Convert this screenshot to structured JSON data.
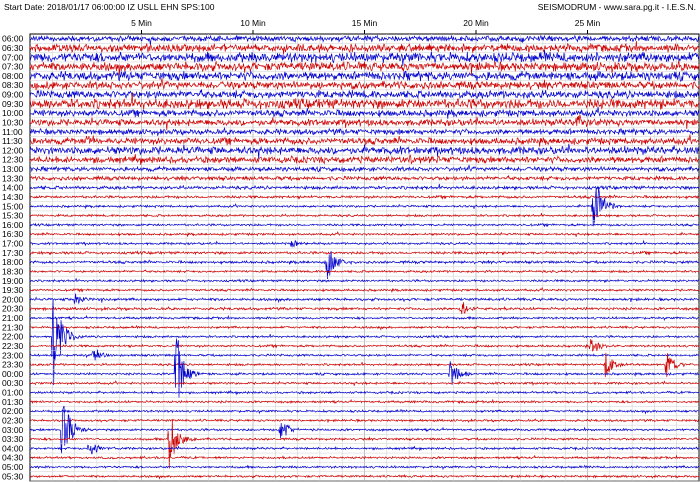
{
  "header": {
    "left": "Start Date: 2018/01/17 06:00:00 IZ USLL EHN SPS:100",
    "right": "SEISMODRUM - www.sara.pg.it - I.E.S.N."
  },
  "chart_data": {
    "type": "line",
    "title": "",
    "x_tick_labels": [
      "5 Min",
      "10 Min",
      "15 Min",
      "20 Min",
      "25 Min"
    ],
    "x_tick_minutes": [
      5,
      10,
      15,
      20,
      25
    ],
    "xlim": [
      0,
      30
    ],
    "row_labels": [
      "06:00",
      "06:30",
      "07:00",
      "07:30",
      "08:00",
      "08:30",
      "09:00",
      "09:30",
      "10:00",
      "10:30",
      "11:00",
      "11:30",
      "12:00",
      "12:30",
      "13:00",
      "13:30",
      "14:00",
      "14:30",
      "15:00",
      "15:30",
      "16:00",
      "16:30",
      "17:00",
      "17:30",
      "18:00",
      "18:30",
      "19:00",
      "19:30",
      "20:00",
      "20:30",
      "21:00",
      "21:30",
      "22:00",
      "22:30",
      "23:00",
      "23:30",
      "00:00",
      "00:30",
      "01:00",
      "01:30",
      "02:00",
      "02:30",
      "03:00",
      "03:30",
      "04:00",
      "04:30",
      "05:00",
      "05:30"
    ],
    "trace_colors": [
      "#0000cc",
      "#cc0000"
    ],
    "grid": true,
    "noise_amplitude": [
      2.5,
      3.5,
      4.5,
      4.0,
      4.0,
      3.5,
      3.5,
      4.5,
      3.0,
      3.0,
      2.5,
      3.0,
      3.5,
      3.0,
      2.0,
      1.8,
      1.5,
      1.2,
      1.0,
      1.0,
      1.0,
      1.0,
      1.0,
      1.2,
      1.2,
      1.0,
      1.0,
      1.0,
      1.2,
      1.2,
      1.0,
      1.0,
      1.0,
      1.0,
      1.0,
      1.0,
      1.0,
      1.0,
      1.0,
      1.0,
      1.0,
      1.0,
      1.0,
      1.0,
      1.0,
      1.0,
      1.0,
      1.0
    ],
    "events": [
      {
        "row": 32,
        "minute": 1.0,
        "amplitude": 60
      },
      {
        "row": 36,
        "minute": 6.5,
        "amplitude": 55
      },
      {
        "row": 42,
        "minute": 1.4,
        "amplitude": 45
      },
      {
        "row": 43,
        "minute": 6.2,
        "amplitude": 35
      },
      {
        "row": 18,
        "minute": 25.2,
        "amplitude": 55
      },
      {
        "row": 24,
        "minute": 13.3,
        "amplitude": 25
      },
      {
        "row": 36,
        "minute": 18.8,
        "amplitude": 18
      },
      {
        "row": 42,
        "minute": 11.2,
        "amplitude": 14
      },
      {
        "row": 35,
        "minute": 25.8,
        "amplitude": 14
      },
      {
        "row": 35,
        "minute": 28.5,
        "amplitude": 16
      },
      {
        "row": 33,
        "minute": 25.1,
        "amplitude": 12
      },
      {
        "row": 29,
        "minute": 19.3,
        "amplitude": 10
      },
      {
        "row": 28,
        "minute": 2.0,
        "amplitude": 8
      },
      {
        "row": 34,
        "minute": 2.8,
        "amplitude": 10
      },
      {
        "row": 9,
        "minute": 24.5,
        "amplitude": 12
      },
      {
        "row": 11,
        "minute": 2.5,
        "amplitude": 10
      },
      {
        "row": 13,
        "minute": 17.0,
        "amplitude": 8
      },
      {
        "row": 44,
        "minute": 2.6,
        "amplitude": 12
      },
      {
        "row": 22,
        "minute": 11.7,
        "amplitude": 6
      }
    ]
  }
}
